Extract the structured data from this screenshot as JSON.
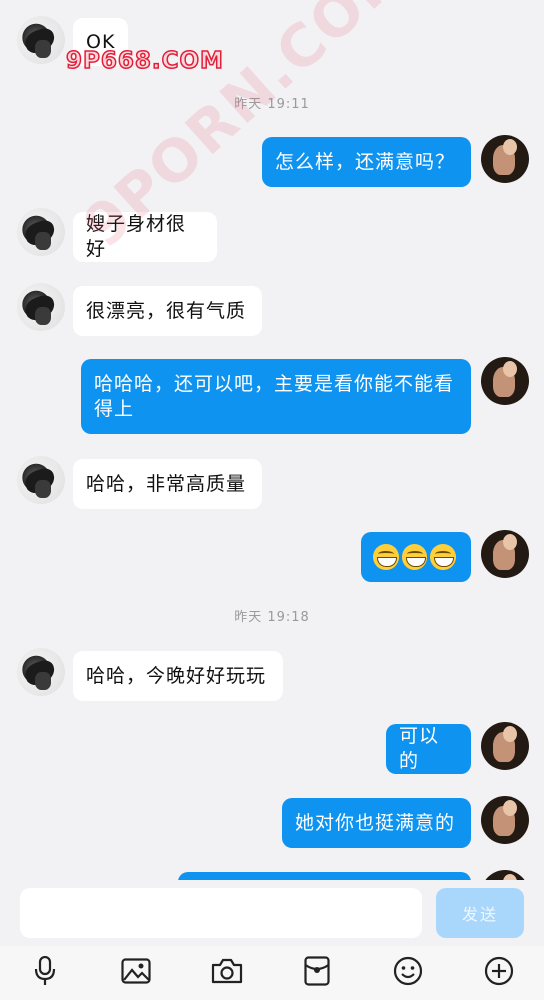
{
  "watermark": {
    "brand": "9P668.COM",
    "diagonal": "9PORN.COM"
  },
  "messages": [
    {
      "text": "OK"
    },
    {
      "text": "怎么样，还满意吗？"
    },
    {
      "text": "嫂子身材很好"
    },
    {
      "text": "很漂亮，很有气质"
    },
    {
      "text": "哈哈哈，还可以吧，主要是看你能不能看得上"
    },
    {
      "text": "哈哈，非常高质量"
    },
    {
      "emoji": "grinning-face x3"
    },
    {
      "text": "哈哈，今晚好好玩玩"
    },
    {
      "text": "可以的"
    },
    {
      "text": "她对你也挺满意的"
    }
  ],
  "timestamps": [
    "昨天 19:11",
    "昨天 19:18"
  ],
  "composer": {
    "placeholder": "",
    "send_label": "发送"
  },
  "toolbar": {
    "icons": [
      "microphone-icon",
      "image-icon",
      "camera-icon",
      "red-packet-icon",
      "emoji-icon",
      "plus-icon"
    ]
  },
  "colors": {
    "outgoing_bubble": "#0f93f0",
    "incoming_bubble": "#ffffff",
    "background": "#f2f2f4",
    "send_disabled": "#a9d6fb"
  }
}
